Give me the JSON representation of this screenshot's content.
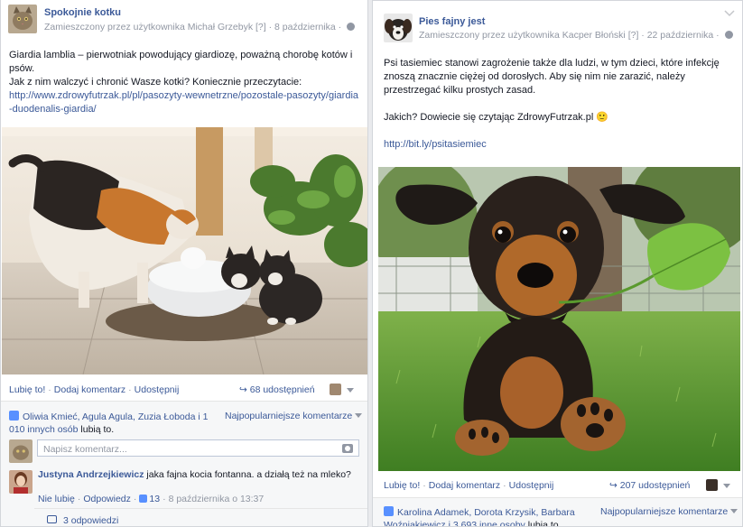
{
  "left_post": {
    "page_name": "Spokojnie kotku",
    "meta_prefix": "Zamieszczony przez użytkownika Michał Grzebyk",
    "meta_flag": "[?]",
    "meta_date": "· 8 października ·",
    "text_line1": "Giardia lamblia – pierwotniak powodujący giardiozę, poważną chorobę kotów i psów.",
    "text_line2": "Jak z nim walczyć i chronić Wasze kotki? Koniecznie przeczytacie:",
    "link": "http://www.zdrowyfutrzak.pl/pl/pasozyty-wewnetrzne/pozostale-pasozyty/giardia-duodenalis-giardia/",
    "like_label": "Lubię to!",
    "comment_label": "Dodaj komentarz",
    "share_label": "Udostępnij",
    "share_count": "68 udostępnień",
    "likes_names": "Oliwia Kmieć, Agula Agula, Zuzia Łoboda i 1 010 innych osób",
    "likes_suffix": "lubią to.",
    "sort_label": "Najpopularniejsze komentarze",
    "comment_placeholder": "Napisz komentarz...",
    "comment": {
      "author": "Justyna Andrzejkiewicz",
      "text": "jaka fajna kocia fontanna. a działą też na mleko?",
      "unlike": "Nie lubię",
      "reply": "Odpowiedz",
      "likes": "13",
      "date": "8 października o 13:37"
    },
    "replies_label": "3 odpowiedzi"
  },
  "right_post": {
    "page_name": "Pies fajny jest",
    "meta_prefix": "Zamieszczony przez użytkownika Kacper Błoński",
    "meta_flag": "[?]",
    "meta_date": "· 22 października ·",
    "text_line1": "Psi tasiemiec stanowi zagrożenie także dla ludzi, w tym dzieci, które infekcję znoszą znacznie ciężej od dorosłych. Aby się nim nie zarazić, należy przestrzegać kilku prostych zasad.",
    "text_line2": "Jakich? Dowiecie się czytając ZdrowyFutrzak.pl 🙂",
    "link": "http://bit.ly/psitasiemiec",
    "like_label": "Lubię to!",
    "comment_label": "Dodaj komentarz",
    "share_label": "Udostępnij",
    "share_count": "207 udostępnień",
    "likes_names": "Karolina Adamek, Dorota Krzysik, Barbara Woźniakiewicz i 3 693 inne osoby",
    "likes_suffix": "lubią to.",
    "sort_label": "Najpopularniejsze komentarze"
  },
  "colors": {
    "link": "#3b5998",
    "meta": "#9197a3",
    "ufi_bg": "#f6f7f8"
  }
}
